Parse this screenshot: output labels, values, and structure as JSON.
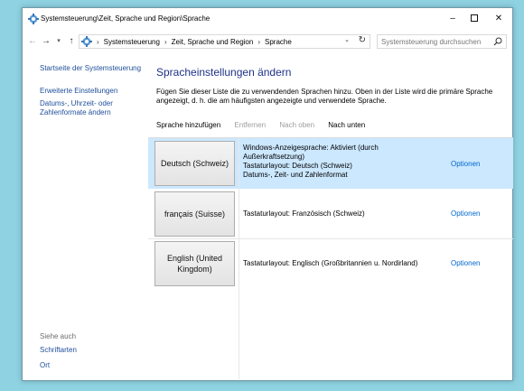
{
  "window": {
    "title": "Systemsteuerung\\Zeit, Sprache und Region\\Sprache",
    "icon": "control-panel-icon",
    "min_label": "–",
    "close_label": "✕"
  },
  "address": {
    "breadcrumbs": [
      "Systemsteuerung",
      "Zeit, Sprache und Region",
      "Sprache"
    ],
    "search_placeholder": "Systemsteuerung durchsuchen"
  },
  "sidebar": {
    "home": "Startseite der Systemsteuerung",
    "links": [
      "Erweiterte Einstellungen",
      "Datums-, Uhrzeit- oder Zahlenformate ändern"
    ],
    "see_also_heading": "Siehe auch",
    "see_also": [
      "Schriftarten",
      "Ort"
    ]
  },
  "main": {
    "title": "Spracheinstellungen ändern",
    "description": "Fügen Sie dieser Liste die zu verwendenden Sprachen hinzu. Oben in der Liste wird die primäre Sprache angezeigt, d. h. die am häufigsten angezeigte und verwendete Sprache.",
    "toolbar": {
      "add": "Sprache hinzufügen",
      "remove": "Entfernen",
      "up": "Nach oben",
      "down": "Nach unten"
    }
  },
  "languages": [
    {
      "name": "Deutsch (Schweiz)",
      "info": [
        "Windows-Anzeigesprache: Aktiviert (durch",
        "Außerkraftsetzung)",
        "Tastaturlayout: Deutsch (Schweiz)",
        "Datums-, Zeit- und Zahlenformat"
      ],
      "options": "Optionen",
      "selected": true
    },
    {
      "name": "français (Suisse)",
      "info": [
        "Tastaturlayout: Französisch (Schweiz)"
      ],
      "options": "Optionen",
      "selected": false
    },
    {
      "name": "English (United Kingdom)",
      "info": [
        "Tastaturlayout: Englisch (Großbritannien u. Nordirland)"
      ],
      "options": "Optionen",
      "selected": false
    }
  ],
  "colors": {
    "desktop": "#8fd3e3",
    "selection": "#cce8ff",
    "title_blue": "#1e3287",
    "link": "#0066cc"
  }
}
